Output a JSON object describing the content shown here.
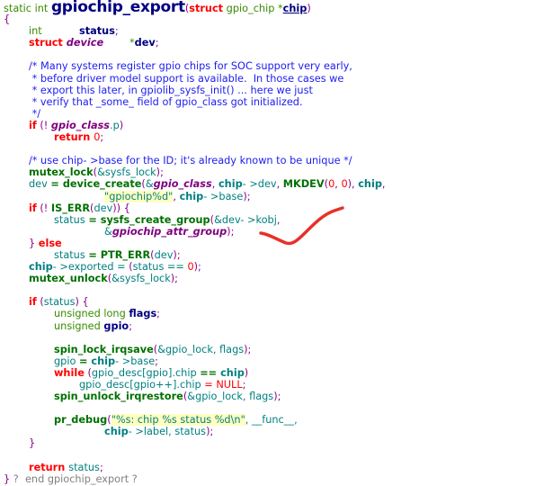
{
  "annotation_color": "#e8302a",
  "lines": [
    [
      [
        "static int ",
        "t"
      ],
      [
        "gpiochip_export",
        "T"
      ],
      [
        "(",
        "p"
      ],
      [
        "struct",
        "k"
      ],
      [
        " gpio_chip ",
        "t"
      ],
      [
        "*",
        "t"
      ],
      [
        "chip",
        "P"
      ],
      [
        ")",
        "p"
      ]
    ],
    [
      [
        "{",
        "p"
      ]
    ],
    [
      [
        "\tint",
        "t"
      ],
      [
        "\t\t",
        ""
      ],
      [
        "status",
        "d"
      ],
      [
        ";",
        "p"
      ]
    ],
    [
      [
        "\tstruct ",
        "k"
      ],
      [
        "device",
        "i"
      ],
      [
        "\t",
        ""
      ],
      [
        "*",
        "t"
      ],
      [
        "dev",
        "d"
      ],
      [
        ";",
        "p"
      ]
    ],
    [],
    [
      [
        "\t/* Many systems register gpio chips for SOC support very early,",
        "c"
      ]
    ],
    [
      [
        "\t * before driver model support is available.  In those cases we",
        "c"
      ]
    ],
    [
      [
        "\t * export this later, in gpiolib_sysfs_init() ... here we just",
        "c"
      ]
    ],
    [
      [
        "\t * verify that _some_ field of gpio_class got initialized.",
        "c"
      ]
    ],
    [
      [
        "\t */",
        "c"
      ]
    ],
    [
      [
        "\tif",
        "k"
      ],
      [
        " (! ",
        "p"
      ],
      [
        "gpio_class",
        "i"
      ],
      [
        ".p",
        "v"
      ],
      [
        ")",
        "p"
      ]
    ],
    [
      [
        "\t\treturn ",
        "k"
      ],
      [
        "0",
        "n"
      ],
      [
        ";",
        "p"
      ]
    ],
    [],
    [
      [
        "\t/* use chip- >base for the ID; it's already known to be unique */",
        "c"
      ]
    ],
    [
      [
        "\tmutex_lock",
        "f"
      ],
      [
        "(",
        "p"
      ],
      [
        "&sysfs_lock",
        "v"
      ],
      [
        ");",
        "p"
      ]
    ],
    [
      [
        "\tdev ",
        "v"
      ],
      [
        "= ",
        "f"
      ],
      [
        "device_create",
        "f"
      ],
      [
        "(",
        "p"
      ],
      [
        "&",
        "v"
      ],
      [
        "gpio_class",
        "i"
      ],
      [
        ", ",
        "p"
      ],
      [
        "chip",
        "m"
      ],
      [
        "- >dev",
        "v"
      ],
      [
        ", ",
        "p"
      ],
      [
        "MKDEV",
        "f"
      ],
      [
        "(",
        "p"
      ],
      [
        "0",
        "n"
      ],
      [
        ", ",
        "p"
      ],
      [
        "0",
        "n"
      ],
      [
        "), ",
        "p"
      ],
      [
        "chip",
        "m"
      ],
      [
        ",",
        "p"
      ]
    ],
    [
      [
        "\t\t\t\t",
        ""
      ],
      [
        "\"gpiochip%d\"",
        "s"
      ],
      [
        ", ",
        "p"
      ],
      [
        "chip",
        "m"
      ],
      [
        "- >base",
        "v"
      ],
      [
        ");",
        "p"
      ]
    ],
    [
      [
        "\tif",
        "k"
      ],
      [
        " (! ",
        "p"
      ],
      [
        "IS_ERR",
        "f"
      ],
      [
        "(",
        "p"
      ],
      [
        "dev",
        "v"
      ],
      [
        ")) {",
        "p"
      ]
    ],
    [
      [
        "\t\tstatus ",
        "v"
      ],
      [
        "= ",
        "f"
      ],
      [
        "sysfs_create_group",
        "f"
      ],
      [
        "(",
        "p"
      ],
      [
        "&dev- >kobj",
        "v"
      ],
      [
        ",",
        "p"
      ]
    ],
    [
      [
        "\t\t\t\t&",
        "v"
      ],
      [
        "gpiochip_attr_group",
        "i"
      ],
      [
        ");",
        "p"
      ]
    ],
    [
      [
        "\t} ",
        "p"
      ],
      [
        "else",
        "k"
      ]
    ],
    [
      [
        "\t\tstatus ",
        "v"
      ],
      [
        "= ",
        "f"
      ],
      [
        "PTR_ERR",
        "f"
      ],
      [
        "(",
        "p"
      ],
      [
        "dev",
        "v"
      ],
      [
        ");",
        "p"
      ]
    ],
    [
      [
        "\tchip",
        "m"
      ],
      [
        "- >exported = ",
        "v"
      ],
      [
        "(",
        "p"
      ],
      [
        "status == ",
        "v"
      ],
      [
        "0",
        "n"
      ],
      [
        ");",
        "p"
      ]
    ],
    [
      [
        "\tmutex_unlock",
        "f"
      ],
      [
        "(",
        "p"
      ],
      [
        "&sysfs_lock",
        "v"
      ],
      [
        ");",
        "p"
      ]
    ],
    [],
    [
      [
        "\tif",
        "k"
      ],
      [
        " (",
        "p"
      ],
      [
        "status",
        "v"
      ],
      [
        ") {",
        "p"
      ]
    ],
    [
      [
        "\t\tunsigned long ",
        "t"
      ],
      [
        "flags",
        "d"
      ],
      [
        ";",
        "p"
      ]
    ],
    [
      [
        "\t\tunsigned ",
        "t"
      ],
      [
        "gpio",
        "d"
      ],
      [
        ";",
        "p"
      ]
    ],
    [],
    [
      [
        "\t\tspin_lock_irqsave",
        "f"
      ],
      [
        "(",
        "p"
      ],
      [
        "&gpio_lock, flags",
        "v"
      ],
      [
        ");",
        "p"
      ]
    ],
    [
      [
        "\t\tgpio ",
        "v"
      ],
      [
        "= ",
        "f"
      ],
      [
        "chip",
        "m"
      ],
      [
        "- >base",
        "v"
      ],
      [
        ";",
        "p"
      ]
    ],
    [
      [
        "\t\twhile",
        "k"
      ],
      [
        " (",
        "p"
      ],
      [
        "gpio_desc[gpio].chip ",
        "v"
      ],
      [
        "== ",
        "f"
      ],
      [
        "chip",
        "m"
      ],
      [
        ")",
        "p"
      ]
    ],
    [
      [
        "\t\t\tgpio_desc[gpio++].chip ",
        "v"
      ],
      [
        "= ",
        "N"
      ],
      [
        "NULL",
        "N"
      ],
      [
        ";",
        "p"
      ]
    ],
    [
      [
        "\t\tspin_unlock_irqrestore",
        "f"
      ],
      [
        "(",
        "p"
      ],
      [
        "&gpio_lock, flags",
        "v"
      ],
      [
        ");",
        "p"
      ]
    ],
    [],
    [
      [
        "\t\tpr_debug",
        "f"
      ],
      [
        "(",
        "p"
      ],
      [
        "\"%s: chip %s status %d\\n\"",
        "s"
      ],
      [
        ", __func__,",
        "v"
      ]
    ],
    [
      [
        "\t\t\t\tchip",
        "m"
      ],
      [
        "- >label, status",
        "v"
      ],
      [
        ");",
        "p"
      ]
    ],
    [
      [
        "\t}",
        "p"
      ]
    ],
    [],
    [
      [
        "\treturn ",
        "k"
      ],
      [
        "status",
        "v"
      ],
      [
        ";",
        "p"
      ]
    ],
    [
      [
        "} ",
        "p"
      ],
      [
        "?  end gpiochip_export ?",
        "g"
      ]
    ]
  ]
}
